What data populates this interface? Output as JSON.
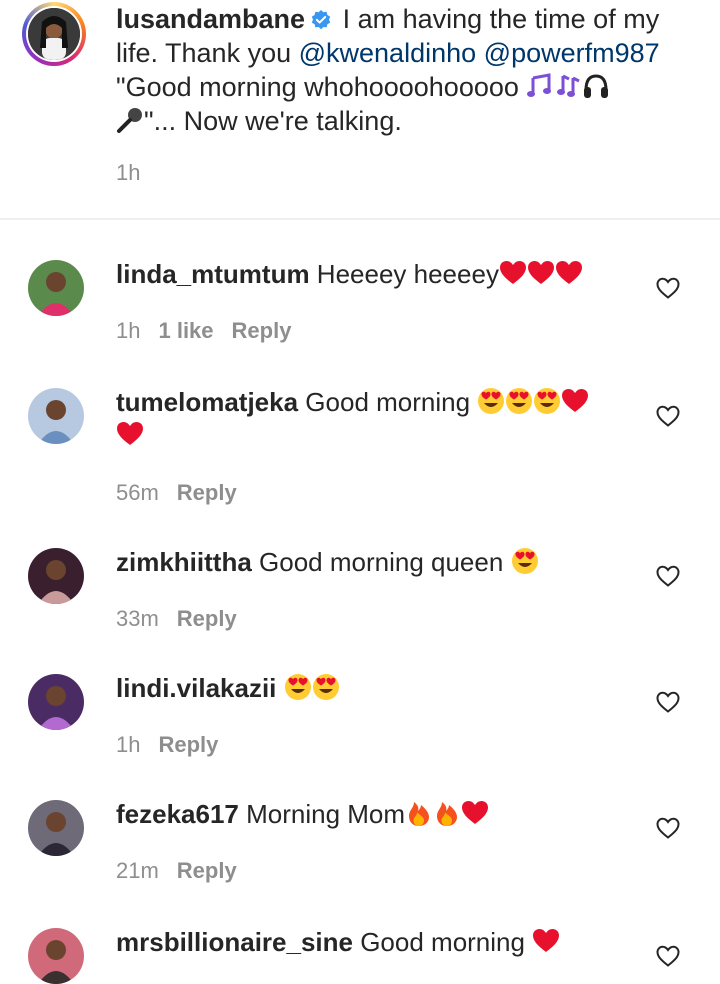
{
  "post": {
    "username": "lusandambane",
    "text_part1": " I am having the time of my life. Thank you ",
    "mention1": "@kwenaldinho",
    "text_space": " ",
    "mention2": "@powerfm987",
    "text_part2": " \"Good morning whohoooohooooo ",
    "text_part3": "\"... Now we're talking.",
    "time": "1h",
    "emojis": [
      "musical-notes",
      "notes",
      "headphones",
      "microphone"
    ]
  },
  "comments": [
    {
      "username": "linda_mtumtum",
      "text": " Heeeey heeeey",
      "emojis": [
        "red-heart",
        "red-heart",
        "red-heart"
      ],
      "time": "1h",
      "likes": "1 like",
      "reply": "Reply",
      "avatar_colors": [
        "#5a8a4c",
        "#e0306a"
      ]
    },
    {
      "username": "tumelomatjeka",
      "text": " Good morning ",
      "emojis": [
        "heart-eyes",
        "heart-eyes",
        "heart-eyes",
        "red-heart",
        "red-heart"
      ],
      "time": "56m",
      "reply": "Reply",
      "avatar_colors": [
        "#b7c9e0",
        "#6b8fbf"
      ]
    },
    {
      "username": "zimkhiittha",
      "text": " Good morning queen ",
      "emojis": [
        "heart-eyes"
      ],
      "time": "33m",
      "reply": "Reply",
      "avatar_colors": [
        "#3a1f2e",
        "#c99a9a"
      ]
    },
    {
      "username": "lindi.vilakazii",
      "text": " ",
      "emojis": [
        "heart-eyes",
        "heart-eyes"
      ],
      "time": "1h",
      "reply": "Reply",
      "avatar_colors": [
        "#4a2b63",
        "#b36ad0"
      ]
    },
    {
      "username": "fezeka617",
      "text": " Morning Mom",
      "emojis": [
        "fire",
        "fire",
        "red-heart"
      ],
      "time": "21m",
      "reply": "Reply",
      "avatar_colors": [
        "#6e6a78",
        "#2b2734"
      ]
    },
    {
      "username": "mrsbillionaire_sine",
      "text": " Good morning ",
      "emojis": [
        "red-heart"
      ],
      "time": "",
      "reply": "",
      "avatar_colors": [
        "#d06a7a",
        "#3a3030"
      ]
    }
  ],
  "colors": {
    "text": "#262626",
    "secondary": "#8e8e8e",
    "mention": "#00376b",
    "verified": "#3897f0",
    "divider": "#efefef"
  }
}
